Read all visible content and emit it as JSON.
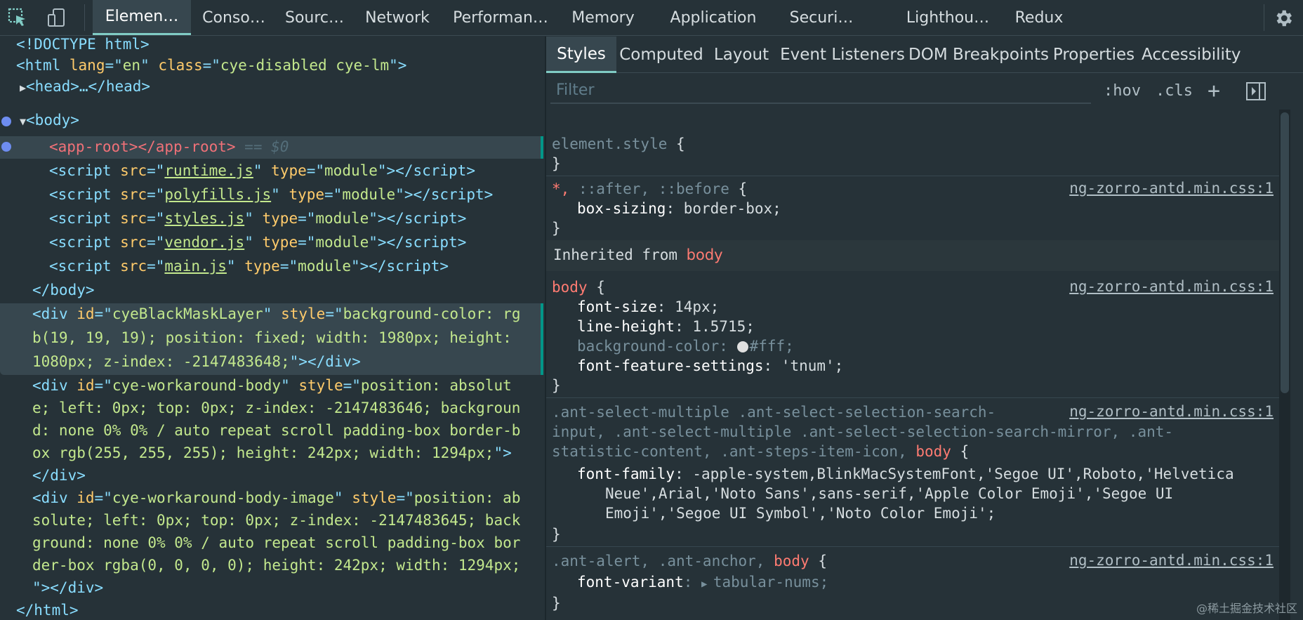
{
  "devtools_tabs": [
    "Elemen…",
    "Conso…",
    "Sourc…",
    "Network",
    "Performan…",
    "Memory",
    "Application",
    "Securi…",
    "Lighthou…",
    "Redux"
  ],
  "active_tab": "Elemen…",
  "dom": {
    "doctype": "<!DOCTYPE html>",
    "html_open": {
      "tag": "html",
      "attrs": [
        {
          "name": "lang",
          "value": "en"
        },
        {
          "name": "class",
          "value": "cye-disabled cye-lm"
        }
      ]
    },
    "head_collapsed": "<head>…</head>",
    "body_open": "<body>",
    "app_root": {
      "open": "<app-root>",
      "close": "</app-root>",
      "marker": "== $0"
    },
    "scripts": [
      {
        "src": "runtime.js",
        "type": "module"
      },
      {
        "src": "polyfills.js",
        "type": "module"
      },
      {
        "src": "styles.js",
        "type": "module"
      },
      {
        "src": "vendor.js",
        "type": "module"
      },
      {
        "src": "main.js",
        "type": "module"
      }
    ],
    "body_close": "</body>",
    "mask_div": {
      "id": "cyeBlackMaskLayer",
      "style_lines": [
        "background-color: rg",
        "b(19, 19, 19); position: fixed; width: 1980px; height:",
        "1080px; z-index: -2147483648;"
      ]
    },
    "workaround_div": {
      "id": "cye-workaround-body",
      "style_lines": [
        "position: absolut",
        "e; left: 0px; top: 0px; z-index: -2147483646; backgroun",
        "d: none 0% 0% / auto repeat scroll padding-box border-b",
        "ox rgb(255, 255, 255); height: 242px; width: 1294px;"
      ]
    },
    "workaround_image_div": {
      "id": "cye-workaround-body-image",
      "style_lines": [
        "position: ab",
        "solute; left: 0px; top: 0px; z-index: -2147483645; back",
        "ground: none 0% 0% / auto repeat scroll padding-box bor",
        "der-box rgba(0, 0, 0, 0); height: 242px; width: 1294px;",
        ""
      ]
    },
    "div_close": "</div>",
    "html_close": "</html>"
  },
  "styles_tabs": [
    "Styles",
    "Computed",
    "Layout",
    "Event Listeners",
    "DOM Breakpoints",
    "Properties",
    "Accessibility"
  ],
  "active_styles_tab": "Styles",
  "filter_placeholder": "Filter",
  "filter_buttons": {
    "hov": ":hov",
    "cls": ".cls",
    "plus": "+"
  },
  "rules": {
    "element_style": "element.style",
    "universal": {
      "selector_star": "*,",
      "selector_rest": " ::after, ::before",
      "source": "ng-zorro-antd.min.css:1",
      "prop": "box-sizing",
      "value": "border-box"
    },
    "inherited_label": "Inherited from",
    "inherited_tag": "body",
    "body_rule": {
      "selector": "body",
      "source": "ng-zorro-antd.min.css:1",
      "decls": [
        {
          "prop": "font-size",
          "value": "14px"
        },
        {
          "prop": "line-height",
          "value": "1.5715"
        },
        {
          "prop": "background-color",
          "value": "#fff"
        },
        {
          "prop": "font-feature-settings",
          "value": "'tnum'"
        }
      ]
    },
    "font_rule": {
      "selector_lines": [
        ".ant-select-multiple .ant-select-selection-search-",
        "input, .ant-select-multiple .ant-select-selection-search-mirror, .ant-",
        "statistic-content, .ant-steps-item-icon, "
      ],
      "selector_tag": "body",
      "source": "ng-zorro-antd.min.css:1",
      "prop": "font-family",
      "value_lines": [
        "-apple-system,BlinkMacSystemFont,'Segoe UI',Roboto,'Helvetica",
        "Neue',Arial,'Noto Sans',sans-serif,'Apple Color Emoji','Segoe UI",
        "Emoji','Segoe UI Symbol','Noto Color Emoji';"
      ]
    },
    "alert_rule": {
      "selector": ".ant-alert, .ant-anchor, ",
      "selector_tag": "body",
      "source": "ng-zorro-antd.min.css:1",
      "prop": "font-variant",
      "value": "tabular-nums;"
    }
  },
  "watermark": "@稀土掘金技术社区",
  "colors": {
    "bg": "#263238",
    "accent": "#80cbc4",
    "tag": "#89ddff",
    "attr": "#ffcb6b",
    "value": "#c3e88d",
    "red": "#f07178"
  }
}
